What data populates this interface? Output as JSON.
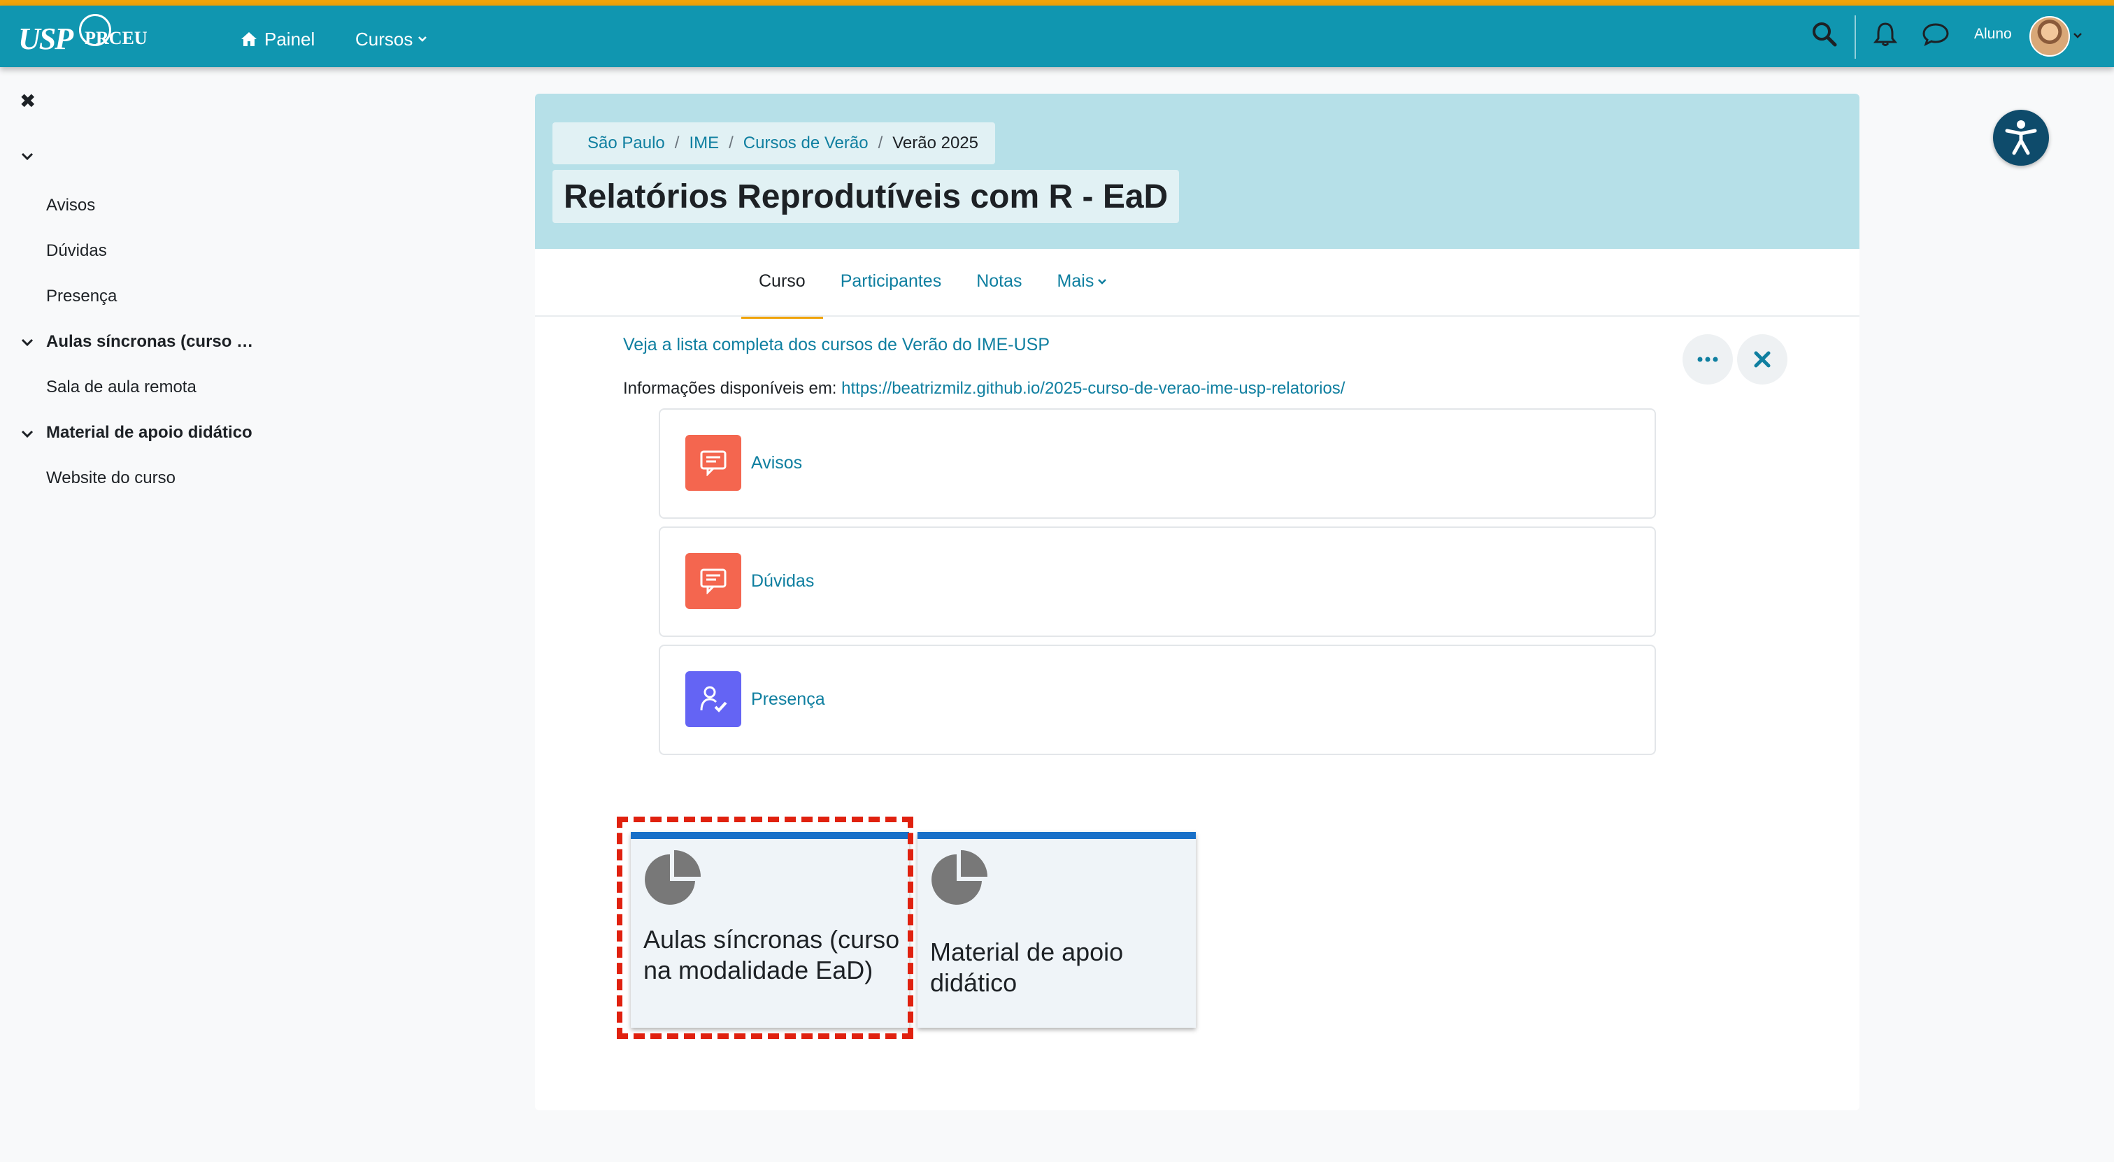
{
  "navbar": {
    "logo_text": "USP",
    "logo_sub": "PRCEU",
    "painel_label": "Painel",
    "cursos_label": "Cursos",
    "user_label": "Aluno"
  },
  "drawer": {
    "items": [
      {
        "label": "Avisos"
      },
      {
        "label": "Dúvidas"
      },
      {
        "label": "Presença"
      },
      {
        "label": "Aulas síncronas (curso …"
      },
      {
        "label": "Sala de aula remota"
      },
      {
        "label": "Material de apoio didático"
      },
      {
        "label": "Website do curso"
      }
    ]
  },
  "breadcrumb": {
    "items": [
      "São Paulo",
      "IME",
      "Cursos de Verão"
    ],
    "current": "Verão 2025"
  },
  "course": {
    "title": "Relatórios Reprodutíveis com R - EaD"
  },
  "tabs": [
    {
      "label": "Curso"
    },
    {
      "label": "Participantes"
    },
    {
      "label": "Notas"
    },
    {
      "label": "Mais"
    }
  ],
  "content": {
    "list_link": "Veja a lista completa dos cursos de Verão do IME-USP",
    "info_label": "Informações disponíveis em:",
    "info_url": "https://beatrizmilz.github.io/2025-curso-de-verao-ime-usp-relatorios/"
  },
  "activities": [
    {
      "name": "Avisos",
      "icon": "forum-icon",
      "color": "#f4664f"
    },
    {
      "name": "Dúvidas",
      "icon": "forum-icon",
      "color": "#f4664f"
    },
    {
      "name": "Presença",
      "icon": "attendance-icon",
      "color": "#6464f4"
    }
  ],
  "tiles": [
    {
      "title": "Aulas síncronas (curso na modalidade EaD)",
      "icon": "pie-chart-icon"
    },
    {
      "title": "Material de apoio didático",
      "icon": "pie-chart-icon"
    }
  ],
  "colors": {
    "navbar": "#1096b0",
    "accent": "#f0a30a",
    "link": "#0f7fa0",
    "header_band": "#b6e0e8",
    "tile_border": "#1870c8",
    "highlight": "#e0210f"
  }
}
